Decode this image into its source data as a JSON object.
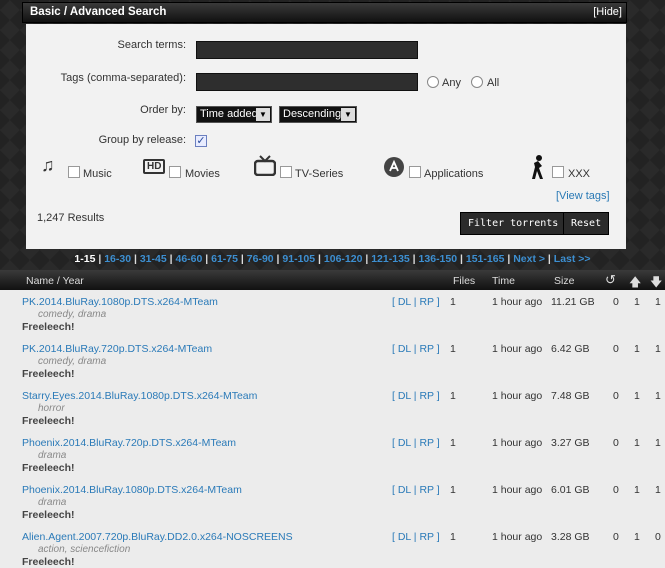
{
  "header": {
    "title": "Basic / Advanced Search",
    "hide_label": "[Hide]"
  },
  "search": {
    "terms_label": "Search terms:",
    "terms_value": "",
    "tags_label": "Tags (comma-separated):",
    "tags_value": "",
    "any_label": "Any",
    "all_label": "All",
    "order_label": "Order by:",
    "order_field": "Time added",
    "order_dir": "Descending",
    "group_label": "Group by release:",
    "group_checked": "✓"
  },
  "categories": [
    {
      "label": "Music",
      "icon": "music-note-icon",
      "glyph": "♫"
    },
    {
      "label": "Movies",
      "icon": "hd-icon",
      "glyph": "HD"
    },
    {
      "label": "TV-Series",
      "icon": "tv-icon",
      "glyph": "📺"
    },
    {
      "label": "Applications",
      "icon": "app-store-icon",
      "glyph": "Ⓐ"
    },
    {
      "label": "XXX",
      "icon": "silhouette-icon",
      "glyph": "♀"
    }
  ],
  "view_tags": "[View tags]",
  "results_count": "1,247 Results",
  "buttons": {
    "filter": "Filter torrents",
    "reset": "Reset"
  },
  "pager": {
    "current": "1-15",
    "pages": [
      "16-30",
      "31-45",
      "46-60",
      "61-75",
      "76-90",
      "91-105",
      "106-120",
      "121-135",
      "136-150",
      "151-165"
    ],
    "next": "Next >",
    "last": "Last >>"
  },
  "table": {
    "headers": {
      "name": "Name / Year",
      "files": "Files",
      "time": "Time",
      "size": "Size",
      "snatched": "↺",
      "seeders": "🡅",
      "leechers": "🡇"
    },
    "rows": [
      {
        "name": "PK.2014.BluRay.1080p.DTS.x264-MTeam",
        "tags": "comedy, drama",
        "free": "Freeleech!",
        "dl": "DL",
        "rp": "RP",
        "files": "1",
        "time": "1 hour ago",
        "size": "11.21 GB",
        "snatched": "0",
        "seeders": "1",
        "leechers": "1"
      },
      {
        "name": "PK.2014.BluRay.720p.DTS.x264-MTeam",
        "tags": "comedy, drama",
        "free": "Freeleech!",
        "dl": "DL",
        "rp": "RP",
        "files": "1",
        "time": "1 hour ago",
        "size": "6.42 GB",
        "snatched": "0",
        "seeders": "1",
        "leechers": "1"
      },
      {
        "name": "Starry.Eyes.2014.BluRay.1080p.DTS.x264-MTeam",
        "tags": "horror",
        "free": "Freeleech!",
        "dl": "DL",
        "rp": "RP",
        "files": "1",
        "time": "1 hour ago",
        "size": "7.48 GB",
        "snatched": "0",
        "seeders": "1",
        "leechers": "1"
      },
      {
        "name": "Phoenix.2014.BluRay.720p.DTS.x264-MTeam",
        "tags": "drama",
        "free": "Freeleech!",
        "dl": "DL",
        "rp": "RP",
        "files": "1",
        "time": "1 hour ago",
        "size": "3.27 GB",
        "snatched": "0",
        "seeders": "1",
        "leechers": "1"
      },
      {
        "name": "Phoenix.2014.BluRay.1080p.DTS.x264-MTeam",
        "tags": "drama",
        "free": "Freeleech!",
        "dl": "DL",
        "rp": "RP",
        "files": "1",
        "time": "1 hour ago",
        "size": "6.01 GB",
        "snatched": "0",
        "seeders": "1",
        "leechers": "1"
      },
      {
        "name": "Alien.Agent.2007.720p.BluRay.DD2.0.x264-NOSCREENS",
        "tags": "action, sciencefiction",
        "free": "Freeleech!",
        "dl": "DL",
        "rp": "RP",
        "files": "1",
        "time": "1 hour ago",
        "size": "3.28 GB",
        "snatched": "0",
        "seeders": "1",
        "leechers": "0"
      }
    ]
  }
}
